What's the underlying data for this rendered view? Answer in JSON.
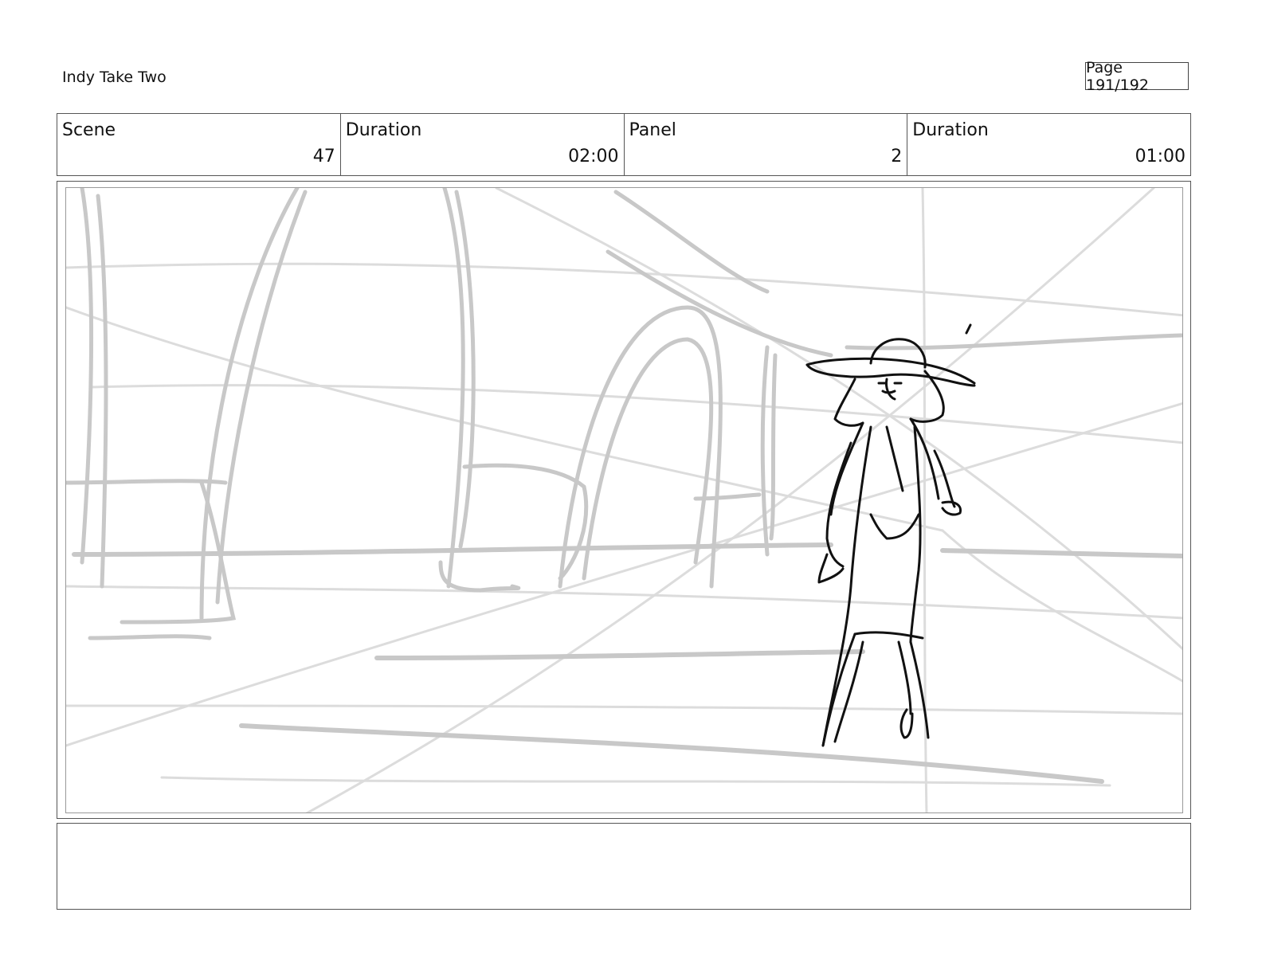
{
  "header": {
    "project_title": "Indy Take Two",
    "page_label": "Page 191/192"
  },
  "info": {
    "scene_label": "Scene",
    "scene_value": "47",
    "scene_duration_label": "Duration",
    "scene_duration_value": "02:00",
    "panel_label": "Panel",
    "panel_value": "2",
    "panel_duration_label": "Duration",
    "panel_duration_value": "01:00"
  },
  "notes": {
    "text": ""
  },
  "colors": {
    "sketch_light": "#c8c8c8",
    "sketch_lighter": "#dcdcdc",
    "ink": "#111111"
  }
}
